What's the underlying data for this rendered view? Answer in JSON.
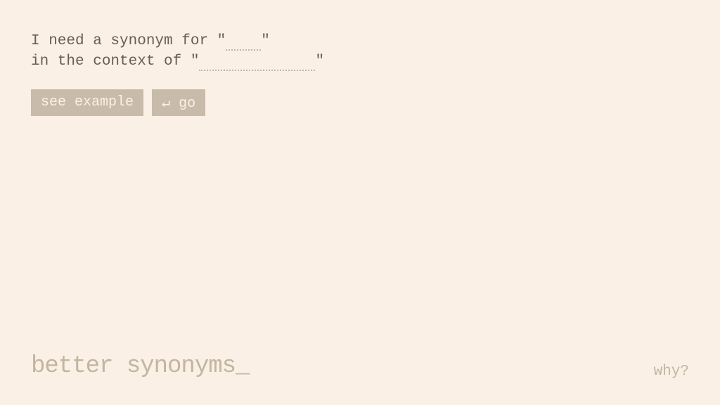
{
  "prompt": {
    "line1_prefix": "I need a synonym for \"",
    "line1_suffix": "\"",
    "line2_prefix": "in the context of \"",
    "line2_suffix": "\"",
    "word_value": "",
    "context_value": ""
  },
  "buttons": {
    "see_example": "see example",
    "go": "↵ go"
  },
  "footer": {
    "logo_text": "better synonyms",
    "logo_cursor": "_",
    "why_link": "why?"
  }
}
